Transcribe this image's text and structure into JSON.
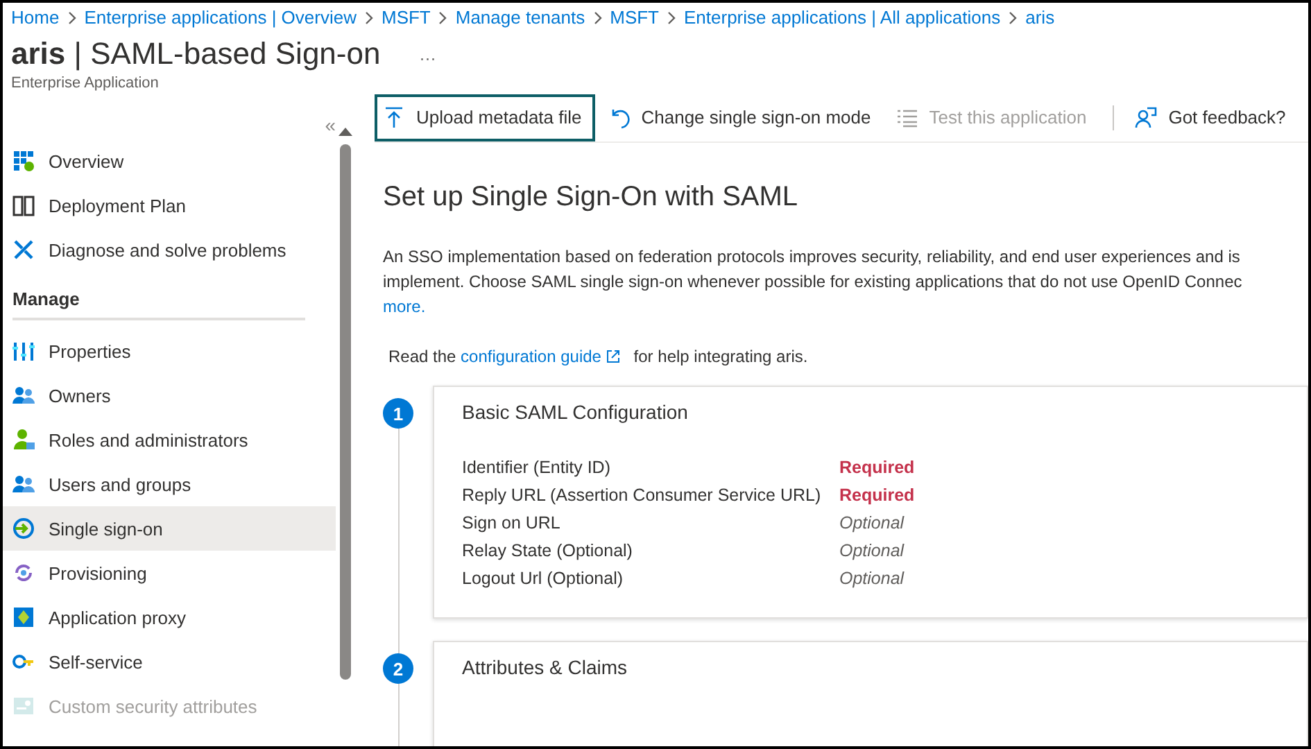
{
  "breadcrumb": [
    "Home",
    "Enterprise applications | Overview",
    "MSFT",
    "Manage tenants",
    "MSFT",
    "Enterprise applications | All applications",
    "aris"
  ],
  "header": {
    "title_bold": "aris",
    "title_rest": " | SAML-based Sign-on",
    "more": "···",
    "subtitle": "Enterprise Application"
  },
  "sidebar": {
    "collapse": "«",
    "items": [
      {
        "kind": "item",
        "label": "Overview",
        "selected": false,
        "disabled": false
      },
      {
        "kind": "item",
        "label": "Deployment Plan",
        "selected": false,
        "disabled": false
      },
      {
        "kind": "item",
        "label": "Diagnose and solve problems",
        "selected": false,
        "disabled": false
      },
      {
        "kind": "section",
        "label": "Manage"
      },
      {
        "kind": "item",
        "label": "Properties",
        "selected": false,
        "disabled": false
      },
      {
        "kind": "item",
        "label": "Owners",
        "selected": false,
        "disabled": false
      },
      {
        "kind": "item",
        "label": "Roles and administrators",
        "selected": false,
        "disabled": false
      },
      {
        "kind": "item",
        "label": "Users and groups",
        "selected": false,
        "disabled": false
      },
      {
        "kind": "item",
        "label": "Single sign-on",
        "selected": true,
        "disabled": false
      },
      {
        "kind": "item",
        "label": "Provisioning",
        "selected": false,
        "disabled": false
      },
      {
        "kind": "item",
        "label": "Application proxy",
        "selected": false,
        "disabled": false
      },
      {
        "kind": "item",
        "label": "Self-service",
        "selected": false,
        "disabled": false
      },
      {
        "kind": "item",
        "label": "Custom security attributes",
        "selected": false,
        "disabled": true
      }
    ]
  },
  "toolbar": [
    {
      "label": "Upload metadata file",
      "focused": true,
      "disabled": false
    },
    {
      "label": "Change single sign-on mode",
      "focused": false,
      "disabled": false
    },
    {
      "label": "Test this application",
      "focused": false,
      "disabled": true
    },
    {
      "label": "Got feedback?",
      "focused": false,
      "disabled": false
    }
  ],
  "heading": "Set up Single Sign-On with SAML",
  "intro_lines": [
    "An SSO implementation based on federation protocols improves security, reliability, and end user experiences and is",
    "implement. Choose SAML single sign-on whenever possible for existing applications that do not use OpenID Connec"
  ],
  "intro_link": "more.",
  "guide": {
    "before": "Read the ",
    "link": "configuration guide",
    "after": " for help integrating aris."
  },
  "steps": [
    {
      "number": "1",
      "title": "Basic SAML Configuration",
      "fields": [
        {
          "label": "Identifier (Entity ID)",
          "value": "Required",
          "kind": "required"
        },
        {
          "label": "Reply URL (Assertion Consumer Service URL)",
          "value": "Required",
          "kind": "required"
        },
        {
          "label": "Sign on URL",
          "value": "Optional",
          "kind": "optional"
        },
        {
          "label": "Relay State (Optional)",
          "value": "Optional",
          "kind": "optional"
        },
        {
          "label": "Logout Url (Optional)",
          "value": "Optional",
          "kind": "optional"
        }
      ]
    },
    {
      "number": "2",
      "title": "Attributes & Claims"
    }
  ]
}
